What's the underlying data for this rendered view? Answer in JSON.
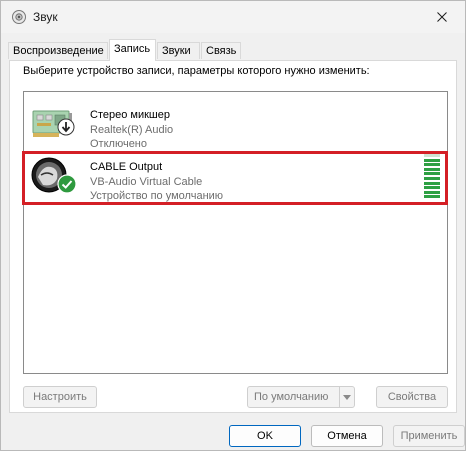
{
  "window": {
    "title": "Звук"
  },
  "tabs": [
    {
      "label": "Воспроизведение",
      "active": false
    },
    {
      "label": "Запись",
      "active": true
    },
    {
      "label": "Звуки",
      "active": false
    },
    {
      "label": "Связь",
      "active": false
    }
  ],
  "panel": {
    "hint": "Выберите устройство записи, параметры которого нужно изменить:"
  },
  "devices": [
    {
      "name": "Стерео микшер",
      "driver": "Realtek(R) Audio",
      "status": "Отключено",
      "icon": "sound-card-icon",
      "badge": "disabled-arrow-icon"
    },
    {
      "name": "CABLE Output",
      "driver": "VB-Audio Virtual Cable",
      "status": "Устройство по умолчанию",
      "icon": "cable-device-icon",
      "badge": "default-check-icon",
      "selected": true,
      "level": 0.85
    }
  ],
  "buttons": {
    "configure": "Настроить",
    "set_default": "По умолчанию",
    "properties": "Свойства",
    "ok": "OK",
    "cancel": "Отмена",
    "apply": "Применить"
  },
  "colors": {
    "accent": "#0067c0",
    "highlight": "#d41f26",
    "meter": "#2ea043"
  }
}
